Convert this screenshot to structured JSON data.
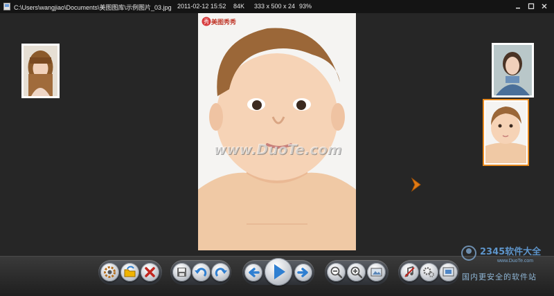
{
  "titlebar": {
    "path": "C:\\Users\\wangjiao\\Documents\\美图图库\\示例图片_03.jpg",
    "date": "2011-02-12 15:52",
    "size": "84K",
    "dimensions": "333 x 500 x 24",
    "zoom": "93%"
  },
  "photo": {
    "badge_text": "美图秀秀",
    "watermark": "www.DuoTe.com"
  },
  "watermark_site": {
    "logo_text": "2345软件大全",
    "url": "www.DuoTe.com",
    "cn_text": "国内更安全的软件站"
  },
  "toolbar": {
    "groups": [
      [
        "settings",
        "open-folder",
        "delete"
      ],
      [
        "save",
        "rotate-left",
        "rotate-right"
      ],
      [
        "previous",
        "play",
        "next"
      ],
      [
        "zoom-out",
        "zoom-in",
        "fit-window"
      ],
      [
        "music",
        "options",
        "fullscreen"
      ]
    ]
  },
  "colors": {
    "background": "#262626",
    "titlebar": "#141414",
    "selection": "#e88a1f",
    "nav_arrow": "#e07a14"
  }
}
